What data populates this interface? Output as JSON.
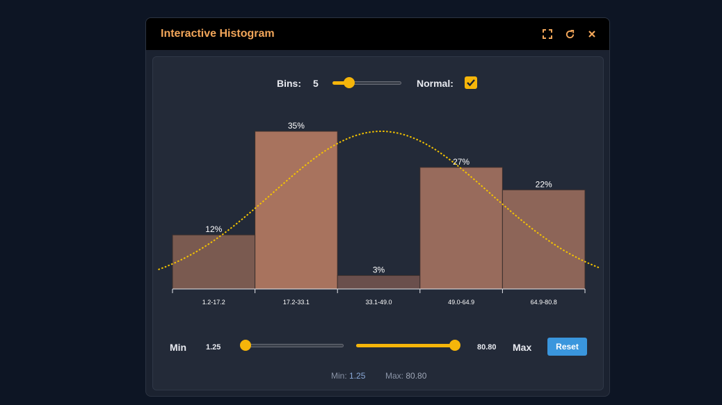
{
  "window": {
    "title": "Interactive Histogram"
  },
  "titlebar_icons": [
    "expand-icon",
    "refresh-icon",
    "close-icon"
  ],
  "controls": {
    "bins_label": "Bins:",
    "bins_value": "5",
    "bins_slider_value": 5,
    "normal_label": "Normal:",
    "normal_checked": true,
    "min_label": "Min",
    "min_value": "1.25",
    "max_label": "Max",
    "max_value": "80.80",
    "reset_label": "Reset"
  },
  "footer": {
    "min_label": "Min:",
    "min_value": "1.25",
    "max_label": "Max:",
    "max_value": "80.80"
  },
  "colors": {
    "accent": "#f5b50a",
    "title": "#f2a65a",
    "reset_button": "#3a96dd",
    "normal_curve": "#f5c400"
  },
  "chart_data": {
    "type": "bar",
    "title": "",
    "xlabel": "",
    "ylabel": "",
    "categories": [
      "1.2-17.2",
      "17.2-33.1",
      "33.1-49.0",
      "49.0-64.9",
      "64.9-80.8"
    ],
    "values": [
      12,
      35,
      3,
      27,
      22
    ],
    "value_labels": [
      "12%",
      "35%",
      "3%",
      "27%",
      "22%"
    ],
    "bar_colors": [
      "#7a5a50",
      "#a8735e",
      "#6a4f4c",
      "#986b5c",
      "#8d6558"
    ],
    "ylim": [
      0,
      37
    ],
    "normal_curve": {
      "mean": 41.5,
      "sd": 21,
      "peak": 35
    },
    "grid": false,
    "legend": "none"
  }
}
